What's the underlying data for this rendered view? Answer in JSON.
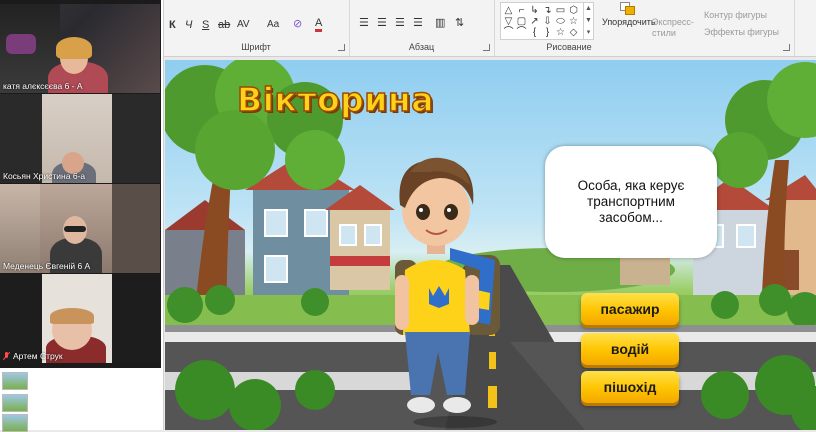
{
  "ribbon": {
    "font_group_label": "Шрифт",
    "paragraph_group_label": "Абзац",
    "drawing_group_label": "Рисование",
    "font_buttons": [
      "К",
      "Ч",
      "S",
      "ab",
      "AV",
      "Aa",
      "A"
    ],
    "arrange_label": "Упорядочить",
    "quick_styles_label": "Экспресс-\nстили",
    "shape_outline_label": "Контур фигуры",
    "shape_effects_label": "Эффекты фигуры",
    "shape_glyphs": [
      "△",
      "⌐",
      "↳",
      "↴",
      "▭",
      "⬡",
      "▽",
      "▢",
      "↗",
      "⇩",
      "⬭",
      "☆",
      "⌒",
      "⌒",
      "{",
      "}",
      "☆",
      "◇"
    ]
  },
  "participants": [
    {
      "name": "катя алєксєєва 6 - А",
      "muted": false
    },
    {
      "name": "Косьян Христина 6-а",
      "muted": false
    },
    {
      "name": "Меденець Євгеній 6 А",
      "muted": false
    },
    {
      "name": "Артем Струк",
      "muted": true
    }
  ],
  "slide": {
    "title": "Вікторина",
    "question": "Особа, яка керує транспортним засобом...",
    "answers": [
      "пасажир",
      "водій",
      "пішохід"
    ]
  },
  "colors": {
    "title_fill": "#ffd21a",
    "title_outline": "#9b4a06",
    "answer_button": "#ffc400",
    "road": "#4a4a4a"
  }
}
